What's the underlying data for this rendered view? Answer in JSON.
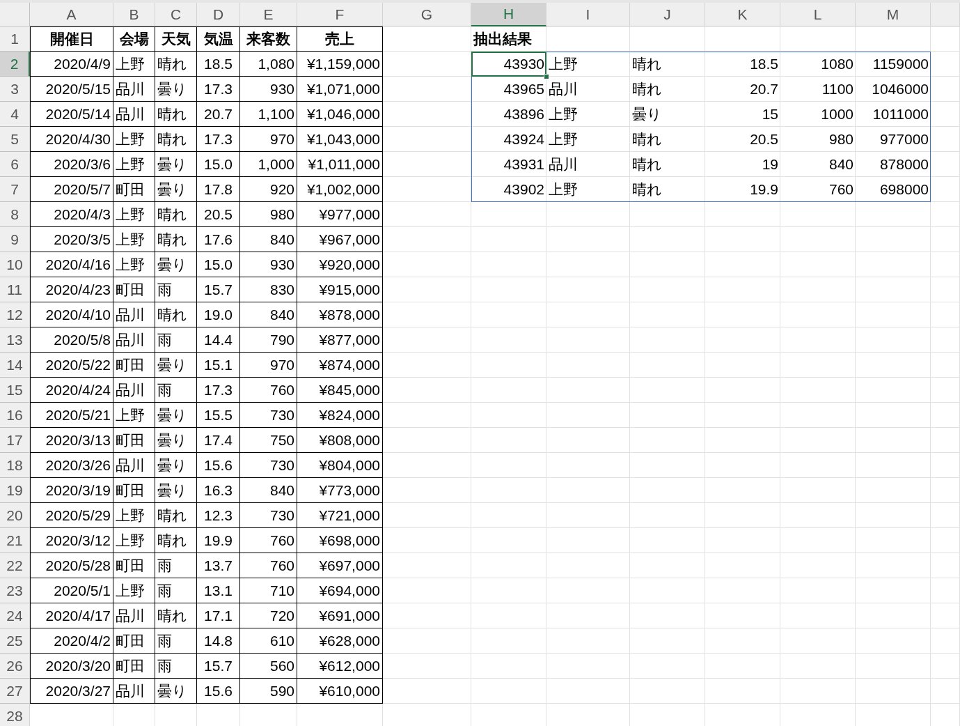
{
  "column_headers": [
    {
      "label": "A",
      "selected": false
    },
    {
      "label": "B",
      "selected": false
    },
    {
      "label": "C",
      "selected": false
    },
    {
      "label": "D",
      "selected": false
    },
    {
      "label": "E",
      "selected": false
    },
    {
      "label": "F",
      "selected": false
    },
    {
      "label": "G",
      "selected": false
    },
    {
      "label": "H",
      "selected": true
    },
    {
      "label": "I",
      "selected": false
    },
    {
      "label": "J",
      "selected": false
    },
    {
      "label": "K",
      "selected": false
    },
    {
      "label": "L",
      "selected": false
    },
    {
      "label": "M",
      "selected": false
    }
  ],
  "row_headers": [
    {
      "label": "1",
      "selected": false
    },
    {
      "label": "2",
      "selected": true
    },
    {
      "label": "3",
      "selected": false
    },
    {
      "label": "4",
      "selected": false
    },
    {
      "label": "5",
      "selected": false
    },
    {
      "label": "6",
      "selected": false
    },
    {
      "label": "7",
      "selected": false
    },
    {
      "label": "8",
      "selected": false
    },
    {
      "label": "9",
      "selected": false
    },
    {
      "label": "10",
      "selected": false
    },
    {
      "label": "11",
      "selected": false
    },
    {
      "label": "12",
      "selected": false
    },
    {
      "label": "13",
      "selected": false
    },
    {
      "label": "14",
      "selected": false
    },
    {
      "label": "15",
      "selected": false
    },
    {
      "label": "16",
      "selected": false
    },
    {
      "label": "17",
      "selected": false
    },
    {
      "label": "18",
      "selected": false
    },
    {
      "label": "19",
      "selected": false
    },
    {
      "label": "20",
      "selected": false
    },
    {
      "label": "21",
      "selected": false
    },
    {
      "label": "22",
      "selected": false
    },
    {
      "label": "23",
      "selected": false
    },
    {
      "label": "24",
      "selected": false
    },
    {
      "label": "25",
      "selected": false
    },
    {
      "label": "26",
      "selected": false
    },
    {
      "label": "27",
      "selected": false
    },
    {
      "label": "28",
      "selected": false
    }
  ],
  "sales_table": {
    "columns": [
      "開催日",
      "会場",
      "天気",
      "気温",
      "来客数",
      "売上"
    ],
    "rows": [
      [
        "2020/4/9",
        "上野",
        "晴れ",
        "18.5",
        "1,080",
        "¥1,159,000"
      ],
      [
        "2020/5/15",
        "品川",
        "曇り",
        "17.3",
        "930",
        "¥1,071,000"
      ],
      [
        "2020/5/14",
        "品川",
        "晴れ",
        "20.7",
        "1,100",
        "¥1,046,000"
      ],
      [
        "2020/4/30",
        "上野",
        "晴れ",
        "17.3",
        "970",
        "¥1,043,000"
      ],
      [
        "2020/3/6",
        "上野",
        "曇り",
        "15.0",
        "1,000",
        "¥1,011,000"
      ],
      [
        "2020/5/7",
        "町田",
        "曇り",
        "17.8",
        "920",
        "¥1,002,000"
      ],
      [
        "2020/4/3",
        "上野",
        "晴れ",
        "20.5",
        "980",
        "¥977,000"
      ],
      [
        "2020/3/5",
        "上野",
        "晴れ",
        "17.6",
        "840",
        "¥967,000"
      ],
      [
        "2020/4/16",
        "上野",
        "曇り",
        "15.0",
        "930",
        "¥920,000"
      ],
      [
        "2020/4/23",
        "町田",
        "雨",
        "15.7",
        "830",
        "¥915,000"
      ],
      [
        "2020/4/10",
        "品川",
        "晴れ",
        "19.0",
        "840",
        "¥878,000"
      ],
      [
        "2020/5/8",
        "品川",
        "雨",
        "14.4",
        "790",
        "¥877,000"
      ],
      [
        "2020/5/22",
        "町田",
        "曇り",
        "15.1",
        "970",
        "¥874,000"
      ],
      [
        "2020/4/24",
        "品川",
        "雨",
        "17.3",
        "760",
        "¥845,000"
      ],
      [
        "2020/5/21",
        "上野",
        "曇り",
        "15.5",
        "730",
        "¥824,000"
      ],
      [
        "2020/3/13",
        "町田",
        "曇り",
        "17.4",
        "750",
        "¥808,000"
      ],
      [
        "2020/3/26",
        "品川",
        "曇り",
        "15.6",
        "730",
        "¥804,000"
      ],
      [
        "2020/3/19",
        "町田",
        "曇り",
        "16.3",
        "840",
        "¥773,000"
      ],
      [
        "2020/5/29",
        "上野",
        "晴れ",
        "12.3",
        "730",
        "¥721,000"
      ],
      [
        "2020/3/12",
        "上野",
        "晴れ",
        "19.9",
        "760",
        "¥698,000"
      ],
      [
        "2020/5/28",
        "町田",
        "雨",
        "13.7",
        "760",
        "¥697,000"
      ],
      [
        "2020/5/1",
        "上野",
        "雨",
        "13.1",
        "710",
        "¥694,000"
      ],
      [
        "2020/4/17",
        "品川",
        "晴れ",
        "17.1",
        "720",
        "¥691,000"
      ],
      [
        "2020/4/2",
        "町田",
        "雨",
        "14.8",
        "610",
        "¥628,000"
      ],
      [
        "2020/3/20",
        "町田",
        "雨",
        "15.7",
        "560",
        "¥612,000"
      ],
      [
        "2020/3/27",
        "品川",
        "曇り",
        "15.6",
        "590",
        "¥610,000"
      ]
    ]
  },
  "result_table": {
    "title": "抽出結果",
    "rows": [
      {
        "values": [
          "43930",
          "上野",
          "晴れ",
          "18.5",
          "1080",
          "1159000"
        ],
        "selected": true
      },
      {
        "values": [
          "43965",
          "品川",
          "晴れ",
          "20.7",
          "1100",
          "1046000"
        ],
        "selected": false
      },
      {
        "values": [
          "43896",
          "上野",
          "曇り",
          "15",
          "1000",
          "1011000"
        ],
        "selected": false
      },
      {
        "values": [
          "43924",
          "上野",
          "晴れ",
          "20.5",
          "980",
          "977000"
        ],
        "selected": false
      },
      {
        "values": [
          "43931",
          "品川",
          "晴れ",
          "19",
          "840",
          "878000"
        ],
        "selected": false
      },
      {
        "values": [
          "43902",
          "上野",
          "晴れ",
          "19.9",
          "760",
          "698000"
        ],
        "selected": false
      }
    ]
  }
}
